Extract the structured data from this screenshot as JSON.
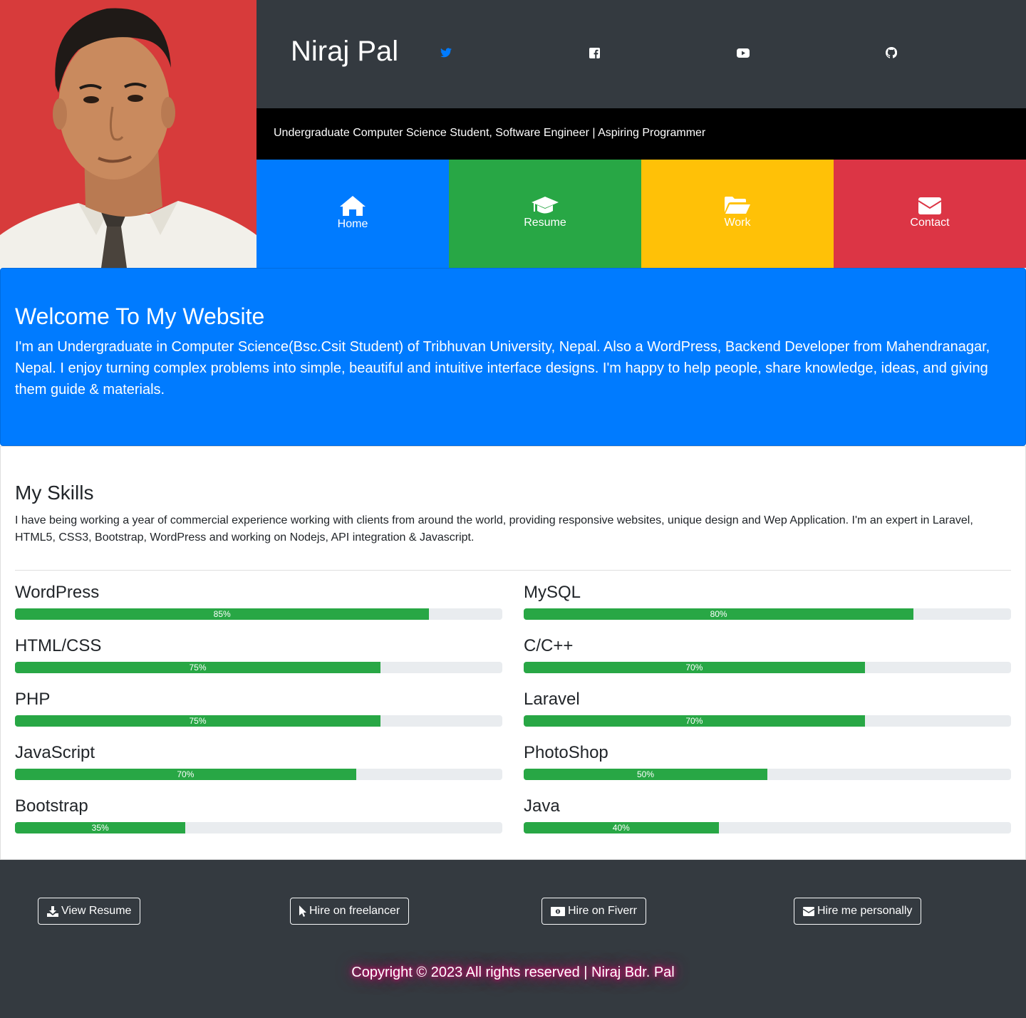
{
  "profile": {
    "name": "Niraj Pal",
    "photo_alt": "Profile photo",
    "tagline": "Undergraduate Computer Science Student, Software Engineer | Aspiring Programmer"
  },
  "social": [
    {
      "icon": "twitter-icon",
      "color": "#007bff"
    },
    {
      "icon": "facebook-icon",
      "color": "#ffffff"
    },
    {
      "icon": "youtube-icon",
      "color": "#ffffff"
    },
    {
      "icon": "github-icon",
      "color": "#ffffff"
    }
  ],
  "nav_tiles": [
    {
      "label": "Home",
      "icon": "home-icon",
      "color": "#007bff"
    },
    {
      "label": "Resume",
      "icon": "graduation-cap-icon",
      "color": "#28a745"
    },
    {
      "label": "Work",
      "icon": "folder-open-icon",
      "color": "#ffc107"
    },
    {
      "label": "Contact",
      "icon": "envelope-icon",
      "color": "#dc3545"
    }
  ],
  "welcome": {
    "title": "Welcome To My Website",
    "text": "I'm an Undergraduate in Computer Science(Bsc.Csit Student) of Tribhuvan University, Nepal. Also a WordPress, Backend Developer from Mahendranagar, Nepal. I enjoy turning complex problems into simple, beautiful and intuitive interface designs. I'm happy to help people, share knowledge, ideas, and giving them guide & materials."
  },
  "skills": {
    "title": "My Skills",
    "intro": "I have being working a year of commercial experience working with clients from around the world, providing responsive websites, unique design and Wep Application. I'm an expert in Laravel, HTML5, CSS3, Bootstrap, WordPress and working on Nodejs, API integration & Javascript.",
    "items": [
      {
        "name": "WordPress",
        "percent": 85,
        "label": "85%"
      },
      {
        "name": "MySQL",
        "percent": 80,
        "label": "80%"
      },
      {
        "name": "HTML/CSS",
        "percent": 75,
        "label": "75%"
      },
      {
        "name": "C/C++",
        "percent": 70,
        "label": "70%"
      },
      {
        "name": "PHP",
        "percent": 75,
        "label": "75%"
      },
      {
        "name": "Laravel",
        "percent": 70,
        "label": "70%"
      },
      {
        "name": "JavaScript",
        "percent": 70,
        "label": "70%"
      },
      {
        "name": "PhotoShop",
        "percent": 50,
        "label": "50%"
      },
      {
        "name": "Bootstrap",
        "percent": 35,
        "label": "35%"
      },
      {
        "name": "Java",
        "percent": 40,
        "label": "40%"
      }
    ]
  },
  "footer": {
    "buttons": [
      {
        "label": "View Resume",
        "icon": "download-icon"
      },
      {
        "label": "Hire on freelancer",
        "icon": "mouse-pointer-icon"
      },
      {
        "label": "Hire on Fiverr",
        "icon": "money-icon"
      },
      {
        "label": "Hire me personally",
        "icon": "envelope-icon"
      }
    ],
    "copyright": "Copyright © 2023 All rights reserved | Niraj Bdr. Pal"
  }
}
